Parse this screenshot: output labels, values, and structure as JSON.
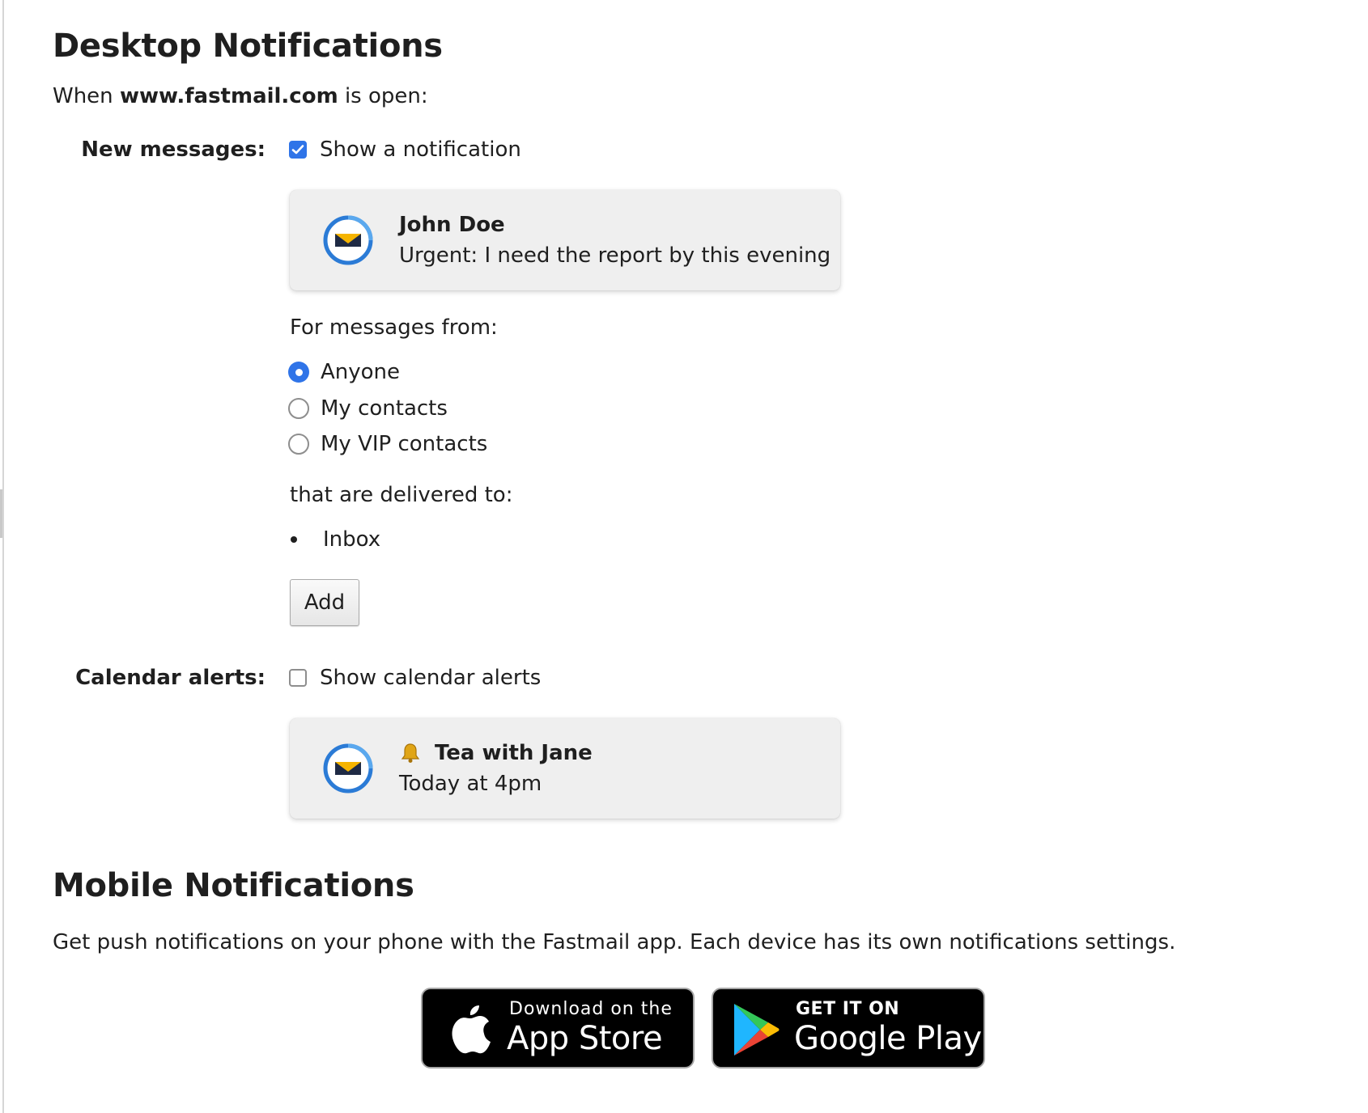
{
  "desktop": {
    "title": "Desktop Notifications",
    "intro_prefix": "When",
    "intro_domain": "www.fastmail.com",
    "intro_suffix": "is open:",
    "new_messages": {
      "label": "New messages:",
      "checkbox_label": "Show a notification",
      "checked": true,
      "preview": {
        "sender": "John Doe",
        "message": "Urgent: I need the report by this evening"
      },
      "from_label": "For messages from:",
      "from_options": [
        {
          "label": "Anyone",
          "selected": true
        },
        {
          "label": "My contacts",
          "selected": false
        },
        {
          "label": "My VIP contacts",
          "selected": false
        }
      ],
      "delivered_label": "that are delivered to:",
      "folders": [
        "Inbox"
      ],
      "add_button": "Add"
    },
    "calendar_alerts": {
      "label": "Calendar alerts:",
      "checkbox_label": "Show calendar alerts",
      "checked": false,
      "preview": {
        "icon": "bell-icon",
        "event": "Tea with Jane",
        "time": "Today at 4pm"
      }
    }
  },
  "mobile": {
    "title": "Mobile Notifications",
    "description": "Get push notifications on your phone with the Fastmail app. Each device has its own notifications settings.",
    "app_store": {
      "small": "Download on the",
      "big": "App Store",
      "icon": "apple-icon"
    },
    "google_play": {
      "small": "GET IT ON",
      "big": "Google Play",
      "icon": "google-play-icon"
    }
  },
  "colors": {
    "accent": "#2f74e8",
    "card_bg": "#efefef",
    "logo_ring": "#2b7bd6",
    "logo_yellow": "#f5b400",
    "logo_dark": "#1f2a44"
  }
}
